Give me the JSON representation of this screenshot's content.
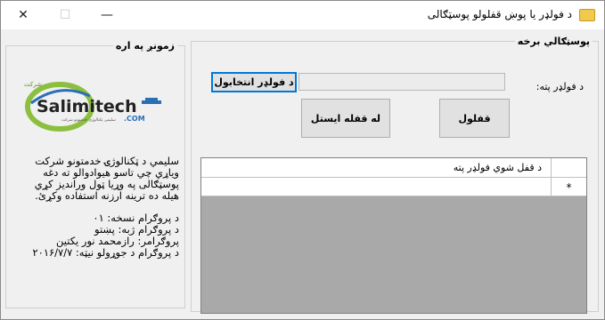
{
  "window": {
    "title": "د فولډر يا پوښ قفلولو پوسټګالی",
    "minimize_glyph": "—",
    "maximize_glyph": "☐",
    "close_glyph": "✕",
    "icon": "folder-lock-icon"
  },
  "about_panel": {
    "legend": "زمونږ په اره",
    "logo": {
      "brand": "Salimitech",
      "suffix": ".COM",
      "tagline": "شرکت خدمات تکنالوژی سلیمی",
      "subtag": "سلیمی ټکنالوژی خدمتونو شرکت",
      "accent_green": "#8cbf3f",
      "accent_blue": "#2a6fb6"
    },
    "description": "سليمي د ټکنالوژۍ خدمتونو شرکت وياړي چي تاسو هيوادوالو ته دغه پوسټګالی په وړيا ټول ورانديز کړي هيله ده ترينه ارزنه استفاده وکړئ.",
    "version_line": "د پروګرام نسخه: ۰۱",
    "language_line": "د پروګرام ژبه: پښتو",
    "developer_line": "پروګرامر: رازمحمد نور يکتين",
    "build_date_line": "د پروګرام د جوړولو نيټه: ۲۰۱۶/۷/۷"
  },
  "main_panel": {
    "legend": "پوسټګالي برخه",
    "folder_path_label": "د فولډر پته:",
    "folder_path_value": "",
    "select_folder_button": "د فولډر انتخابول",
    "unlock_button": "له قفله ايستل",
    "lock_button": "قفلول",
    "grid": {
      "column_header": "د قفل شوي فولډر پته",
      "new_row_marker": "*"
    }
  }
}
